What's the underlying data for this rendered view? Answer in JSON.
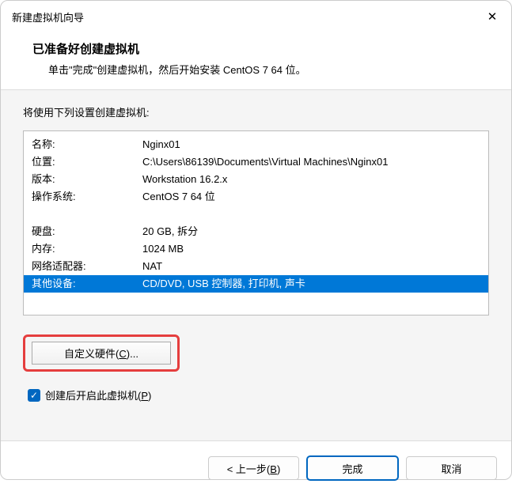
{
  "window": {
    "title": "新建虚拟机向导"
  },
  "header": {
    "title": "已准备好创建虚拟机",
    "subtitle": "单击\"完成\"创建虚拟机，然后开始安装 CentOS 7 64 位。"
  },
  "body": {
    "prompt": "将使用下列设置创建虚拟机:",
    "rows": [
      {
        "k": "名称:",
        "v": "Nginx01"
      },
      {
        "k": "位置:",
        "v": "C:\\Users\\86139\\Documents\\Virtual Machines\\Nginx01"
      },
      {
        "k": "版本:",
        "v": "Workstation 16.2.x"
      },
      {
        "k": "操作系统:",
        "v": "CentOS 7 64 位"
      }
    ],
    "rows2": [
      {
        "k": "硬盘:",
        "v": "20 GB, 拆分"
      },
      {
        "k": "内存:",
        "v": "1024 MB"
      },
      {
        "k": "网络适配器:",
        "v": "NAT"
      }
    ],
    "selected": {
      "k": "其他设备:",
      "v": "CD/DVD, USB 控制器, 打印机, 声卡"
    },
    "custom_btn_pre": "自定义硬件(",
    "custom_btn_u": "C",
    "custom_btn_post": ")...",
    "chk_pre": "创建后开启此虚拟机(",
    "chk_u": "P",
    "chk_post": ")"
  },
  "footer": {
    "back_pre": "< 上一步(",
    "back_u": "B",
    "back_post": ")",
    "finish": "完成",
    "cancel": "取消"
  }
}
